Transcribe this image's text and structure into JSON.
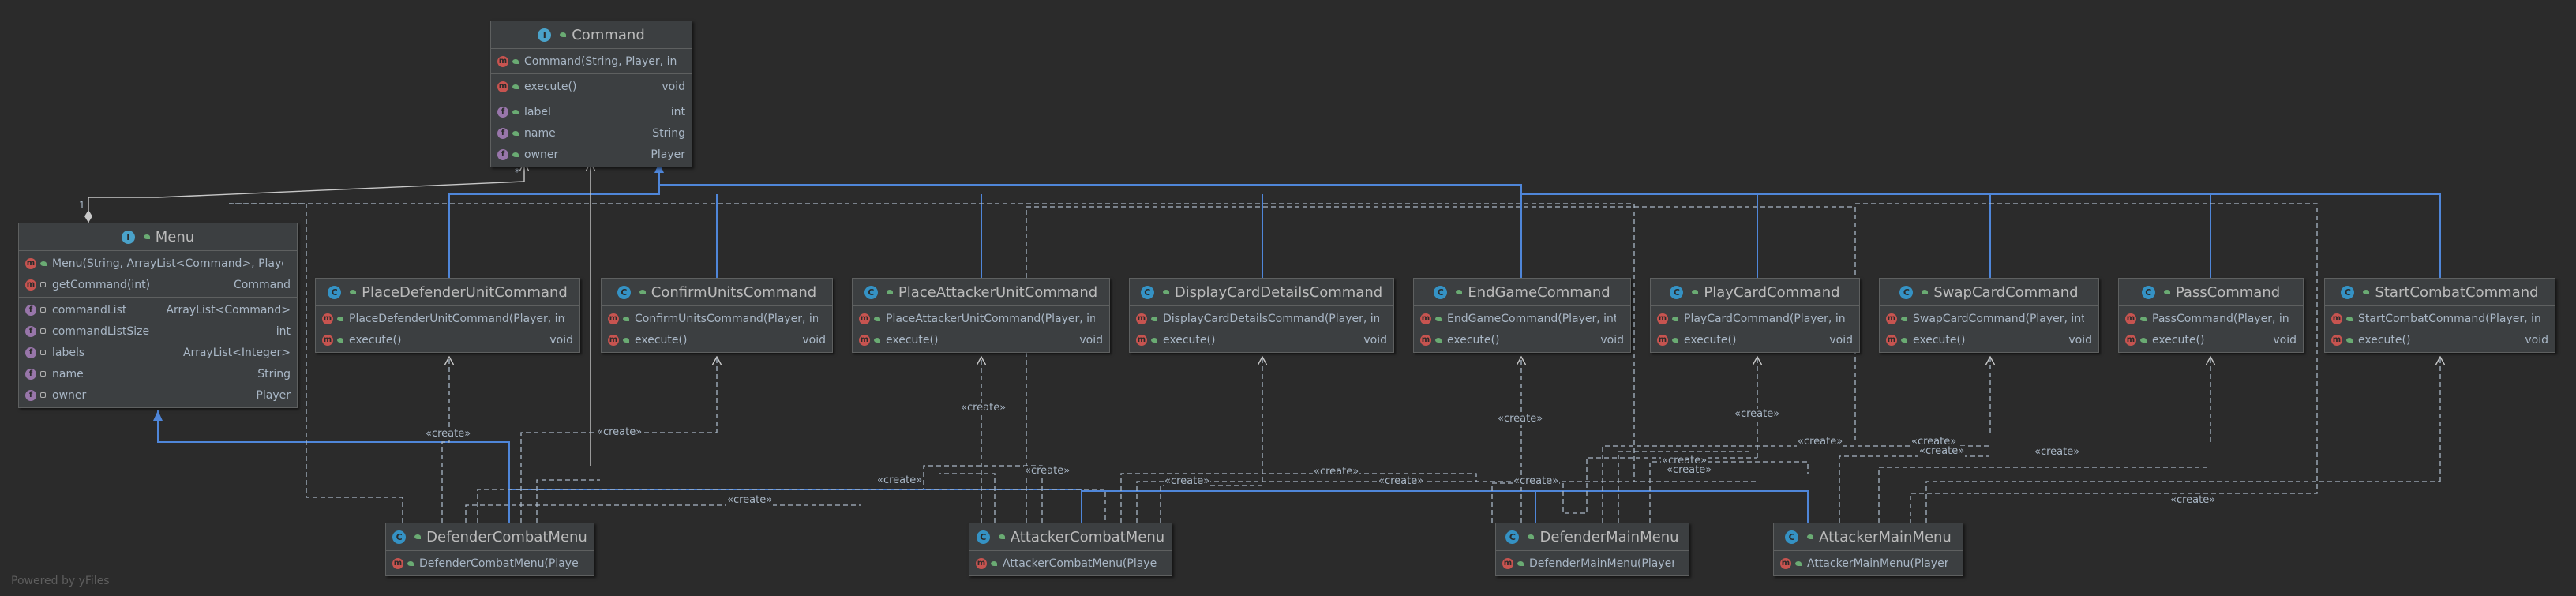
{
  "nodes": {
    "command": {
      "title": "Command",
      "kind": "interface",
      "members": [
        [
          {
            "kind": "method",
            "vis": "public",
            "name": "Command(String, Player, int)",
            "type": ""
          }
        ],
        [
          {
            "kind": "method",
            "vis": "public",
            "name": "execute()",
            "type": "void"
          }
        ],
        [
          {
            "kind": "field",
            "vis": "public",
            "name": "label",
            "type": "int"
          },
          {
            "kind": "field",
            "vis": "public",
            "name": "name",
            "type": "String"
          },
          {
            "kind": "field",
            "vis": "public",
            "name": "owner",
            "type": "Player"
          }
        ]
      ]
    },
    "menu": {
      "title": "Menu",
      "kind": "interface",
      "members": [
        [
          {
            "kind": "method",
            "vis": "public",
            "name": "Menu(String, ArrayList<Command>, Player)",
            "type": ""
          },
          {
            "kind": "method",
            "vis": "package",
            "name": "getCommand(int)",
            "type": "Command"
          }
        ],
        [
          {
            "kind": "field",
            "vis": "package",
            "name": "commandList",
            "type": "ArrayList<Command>"
          },
          {
            "kind": "field",
            "vis": "package",
            "name": "commandListSize",
            "type": "int"
          },
          {
            "kind": "field",
            "vis": "package",
            "name": "labels",
            "type": "ArrayList<Integer>"
          },
          {
            "kind": "field",
            "vis": "package",
            "name": "name",
            "type": "String"
          },
          {
            "kind": "field",
            "vis": "package",
            "name": "owner",
            "type": "Player"
          }
        ]
      ]
    },
    "placeDefenderUnitCommand": {
      "title": "PlaceDefenderUnitCommand",
      "kind": "class",
      "members": [
        [
          {
            "kind": "method",
            "vis": "public",
            "name": "PlaceDefenderUnitCommand(Player, int)",
            "type": ""
          },
          {
            "kind": "method",
            "vis": "public",
            "name": "execute()",
            "type": "void"
          }
        ]
      ]
    },
    "confirmUnitsCommand": {
      "title": "ConfirmUnitsCommand",
      "kind": "class",
      "members": [
        [
          {
            "kind": "method",
            "vis": "public",
            "name": "ConfirmUnitsCommand(Player, int)",
            "type": ""
          },
          {
            "kind": "method",
            "vis": "public",
            "name": "execute()",
            "type": "void"
          }
        ]
      ]
    },
    "placeAttackerUnitCommand": {
      "title": "PlaceAttackerUnitCommand",
      "kind": "class",
      "members": [
        [
          {
            "kind": "method",
            "vis": "public",
            "name": "PlaceAttackerUnitCommand(Player, int)",
            "type": ""
          },
          {
            "kind": "method",
            "vis": "public",
            "name": "execute()",
            "type": "void"
          }
        ]
      ]
    },
    "displayCardDetailsCommand": {
      "title": "DisplayCardDetailsCommand",
      "kind": "class",
      "members": [
        [
          {
            "kind": "method",
            "vis": "public",
            "name": "DisplayCardDetailsCommand(Player, int)",
            "type": ""
          },
          {
            "kind": "method",
            "vis": "public",
            "name": "execute()",
            "type": "void"
          }
        ]
      ]
    },
    "endGameCommand": {
      "title": "EndGameCommand",
      "kind": "class",
      "members": [
        [
          {
            "kind": "method",
            "vis": "public",
            "name": "EndGameCommand(Player, int)",
            "type": ""
          },
          {
            "kind": "method",
            "vis": "public",
            "name": "execute()",
            "type": "void"
          }
        ]
      ]
    },
    "playCardCommand": {
      "title": "PlayCardCommand",
      "kind": "class",
      "members": [
        [
          {
            "kind": "method",
            "vis": "public",
            "name": "PlayCardCommand(Player, int)",
            "type": ""
          },
          {
            "kind": "method",
            "vis": "public",
            "name": "execute()",
            "type": "void"
          }
        ]
      ]
    },
    "swapCardCommand": {
      "title": "SwapCardCommand",
      "kind": "class",
      "members": [
        [
          {
            "kind": "method",
            "vis": "public",
            "name": "SwapCardCommand(Player, int)",
            "type": ""
          },
          {
            "kind": "method",
            "vis": "public",
            "name": "execute()",
            "type": "void"
          }
        ]
      ]
    },
    "passCommand": {
      "title": "PassCommand",
      "kind": "class",
      "members": [
        [
          {
            "kind": "method",
            "vis": "public",
            "name": "PassCommand(Player, int)",
            "type": ""
          },
          {
            "kind": "method",
            "vis": "public",
            "name": "execute()",
            "type": "void"
          }
        ]
      ]
    },
    "startCombatCommand": {
      "title": "StartCombatCommand",
      "kind": "class",
      "members": [
        [
          {
            "kind": "method",
            "vis": "public",
            "name": "StartCombatCommand(Player, int)",
            "type": ""
          },
          {
            "kind": "method",
            "vis": "public",
            "name": "execute()",
            "type": "void"
          }
        ]
      ]
    },
    "defenderCombatMenu": {
      "title": "DefenderCombatMenu",
      "kind": "class",
      "members": [
        [
          {
            "kind": "method",
            "vis": "public",
            "name": "DefenderCombatMenu(Player)",
            "type": ""
          }
        ]
      ]
    },
    "attackerCombatMenu": {
      "title": "AttackerCombatMenu",
      "kind": "class",
      "members": [
        [
          {
            "kind": "method",
            "vis": "public",
            "name": "AttackerCombatMenu(Player)",
            "type": ""
          }
        ]
      ]
    },
    "defenderMainMenu": {
      "title": "DefenderMainMenu",
      "kind": "class",
      "members": [
        [
          {
            "kind": "method",
            "vis": "public",
            "name": "DefenderMainMenu(Player)",
            "type": ""
          }
        ]
      ]
    },
    "attackerMainMenu": {
      "title": "AttackerMainMenu",
      "kind": "class",
      "members": [
        [
          {
            "kind": "method",
            "vis": "public",
            "name": "AttackerMainMenu(Player)",
            "type": ""
          }
        ]
      ]
    }
  },
  "edge_labels": {
    "create": "«create»",
    "multiplicity_one": "1",
    "multiplicity_many": "*"
  },
  "footer": "Powered by yFiles",
  "colors": {
    "background": "#2b2b2b",
    "node_fill": "#3c3f41",
    "node_border": "#5e6060",
    "inheritance": "#4f86d9",
    "dependency": "#a9b7c6",
    "text": "#a9b7c6"
  }
}
